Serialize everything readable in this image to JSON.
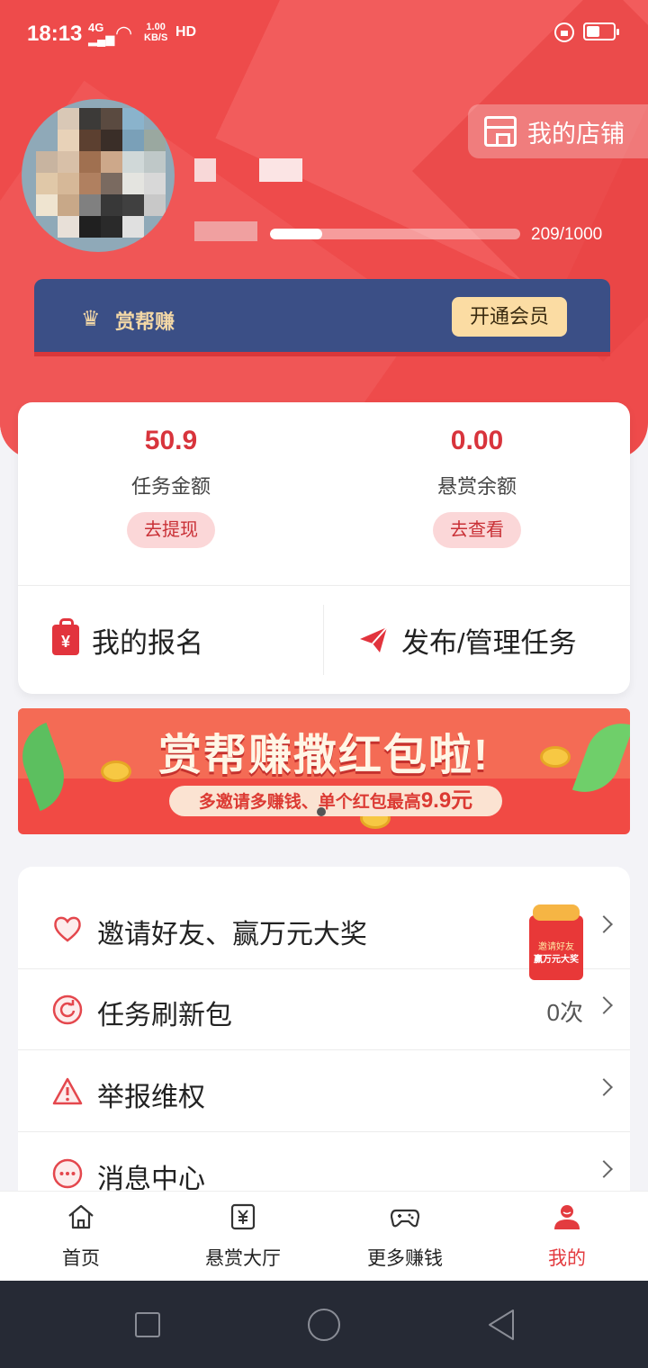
{
  "status_bar": {
    "time": "18:13",
    "network": "4G",
    "speed_value": "1.00",
    "speed_unit": "KB/S",
    "hd": "HD",
    "battery_level": 0.5
  },
  "profile": {
    "store_button": "我的店铺",
    "level_progress": "209/1000",
    "level_current": 209,
    "level_max": 1000
  },
  "vip": {
    "brand": "赏帮赚",
    "open_button": "开通会员"
  },
  "stats": [
    {
      "value": "50.9",
      "label": "任务金额",
      "action": "去提现"
    },
    {
      "value": "0.00",
      "label": "悬赏余额",
      "action": "去查看"
    }
  ],
  "actions": {
    "my_signups": "我的报名",
    "publish_manage": "发布/管理任务"
  },
  "banner": {
    "title": "赏帮赚撒红包啦!",
    "subtitle_pre": "多邀请多赚钱、单个红包最高",
    "subtitle_amount": "9.9元"
  },
  "menu": {
    "invite": {
      "label": "邀请好友、赢万元大奖",
      "promo_line1": "邀请好友",
      "promo_line2": "赢万元大奖"
    },
    "refresh": {
      "label": "任务刷新包",
      "value": "0次"
    },
    "report": {
      "label": "举报维权"
    },
    "messages": {
      "label": "消息中心"
    }
  },
  "tabs": [
    {
      "label": "首页",
      "icon": "home-icon"
    },
    {
      "label": "悬赏大厅",
      "icon": "yuan-icon"
    },
    {
      "label": "更多赚钱",
      "icon": "gamepad-icon"
    },
    {
      "label": "我的",
      "icon": "user-icon"
    }
  ],
  "colors": {
    "accent_red": "#ee4b4b",
    "vip_blue": "#3b4f86",
    "gold": "#fbdca3"
  }
}
